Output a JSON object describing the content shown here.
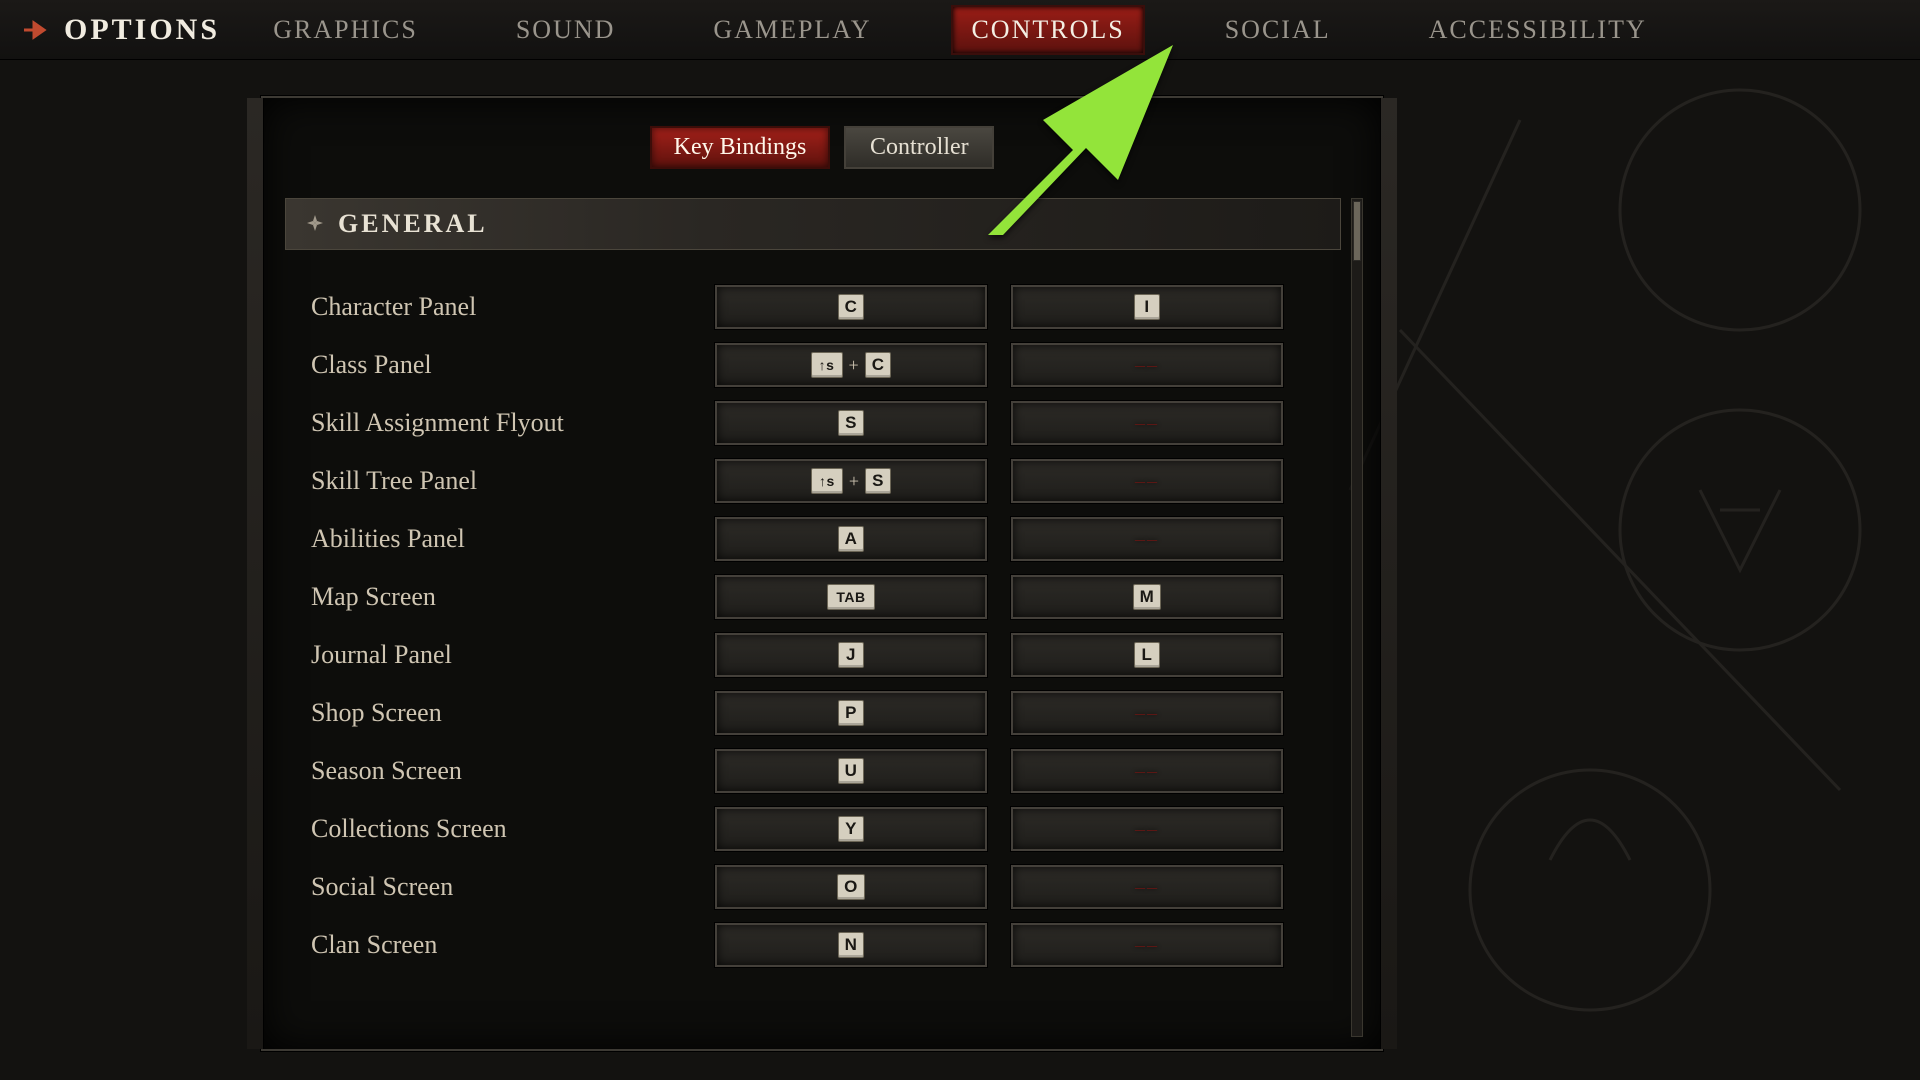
{
  "header": {
    "title": "OPTIONS",
    "tabs": [
      {
        "label": "GRAPHICS",
        "active": false
      },
      {
        "label": "SOUND",
        "active": false
      },
      {
        "label": "GAMEPLAY",
        "active": false
      },
      {
        "label": "CONTROLS",
        "active": true
      },
      {
        "label": "SOCIAL",
        "active": false
      },
      {
        "label": "ACCESSIBILITY",
        "active": false
      }
    ]
  },
  "subtabs": [
    {
      "label": "Key Bindings",
      "active": true
    },
    {
      "label": "Controller",
      "active": false
    }
  ],
  "section": {
    "title": "GENERAL"
  },
  "bindings": [
    {
      "label": "Character Panel",
      "primary": [
        "C"
      ],
      "secondary": [
        "I"
      ]
    },
    {
      "label": "Class Panel",
      "primary": [
        "SHIFT",
        "C"
      ],
      "secondary": null
    },
    {
      "label": "Skill Assignment Flyout",
      "primary": [
        "S"
      ],
      "secondary": null
    },
    {
      "label": "Skill Tree Panel",
      "primary": [
        "SHIFT",
        "S"
      ],
      "secondary": null
    },
    {
      "label": "Abilities Panel",
      "primary": [
        "A"
      ],
      "secondary": null
    },
    {
      "label": "Map Screen",
      "primary": [
        "TAB"
      ],
      "secondary": [
        "M"
      ]
    },
    {
      "label": "Journal Panel",
      "primary": [
        "J"
      ],
      "secondary": [
        "L"
      ]
    },
    {
      "label": "Shop Screen",
      "primary": [
        "P"
      ],
      "secondary": null
    },
    {
      "label": "Season Screen",
      "primary": [
        "U"
      ],
      "secondary": null
    },
    {
      "label": "Collections Screen",
      "primary": [
        "Y"
      ],
      "secondary": null
    },
    {
      "label": "Social Screen",
      "primary": [
        "O"
      ],
      "secondary": null
    },
    {
      "label": "Clan Screen",
      "primary": [
        "N"
      ],
      "secondary": null
    }
  ],
  "unbound_glyph": "––",
  "plus_glyph": "+",
  "annotation": {
    "type": "arrow",
    "color": "#93e43a",
    "points_to": "CONTROLS tab"
  }
}
